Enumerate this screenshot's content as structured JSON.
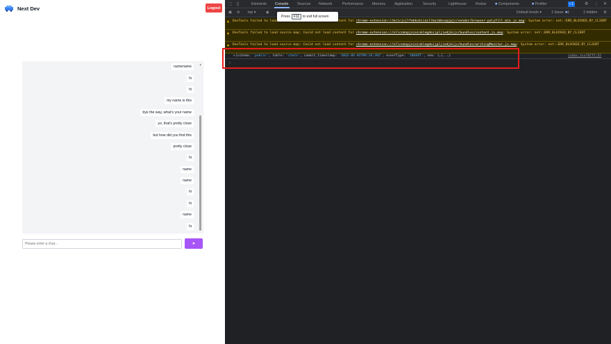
{
  "app": {
    "brand": "Next Dev",
    "logout_label": "Logout",
    "messages": [
      "namename",
      "hi",
      "hi",
      "my name is this",
      "bye the way, what's your name",
      "yo, that's pretty close",
      "but how did you find this",
      "pretty close",
      "hi",
      "name",
      "name",
      "hi",
      "hi",
      "name",
      "hi"
    ],
    "input_placeholder": "Please enter a chat...",
    "send_icon": "paper-plane-icon"
  },
  "devtools": {
    "tabs": [
      "Elements",
      "Console",
      "Sources",
      "Network",
      "Performance",
      "Memory",
      "Application",
      "Security",
      "Lighthouse",
      "Redux",
      "Components",
      "Profiler"
    ],
    "active_tab": "Console",
    "issue_badge": "1",
    "context": "top",
    "default_levels": "Default levels",
    "issues_label": "1 Issue:",
    "issues_count": "1",
    "hidden_label": "1 hidden",
    "tooltip": {
      "pre": "Press",
      "key": "F11",
      "post": "to exit full screen"
    },
    "warnings": [
      {
        "text": "DevTools failed to load source map: Could not load content for ",
        "link": "chrome-extension://mcicjcjlfebkcbiiaillkoibbcopjpjc/vendor/browser-polyfill.min.js.map",
        "suffix": ": System error: net::ERR_BLOCKED_BY_CLIENT"
      },
      {
        "text": "DevTools failed to load source map: Could not load content for ",
        "link": "chrome-extension://nllcnknpjnininklegdoijpljiedjkijc/bundles/content.js.map",
        "suffix": ": System error: net::ERR_BLOCKED_BY_CLIENT"
      },
      {
        "text": "DevTools failed to load source map: Could not load content for ",
        "link": "chrome-extension://nllcnknpjnininklegdoijpljiedjkijc/bundles/writingMonitor.js.map",
        "suffix": ": System error: net::ERR_BLOCKED_BY_CLIENT"
      }
    ],
    "log": {
      "open": "{",
      "schema_key": "schema: ",
      "schema_val": "'public'",
      "table_key": ", table: ",
      "table_val": "'chats'",
      "ts_key": ", commit_timestamp: ",
      "ts_val": "'2022-06-03T09:16:39Z'",
      "event_key": ", eventType: ",
      "event_val": "'INSERT'",
      "new_key": ", new: ",
      "new_val": "{…}, …}",
      "source": "index.tsx?07ff:52"
    },
    "prompt": ">"
  }
}
